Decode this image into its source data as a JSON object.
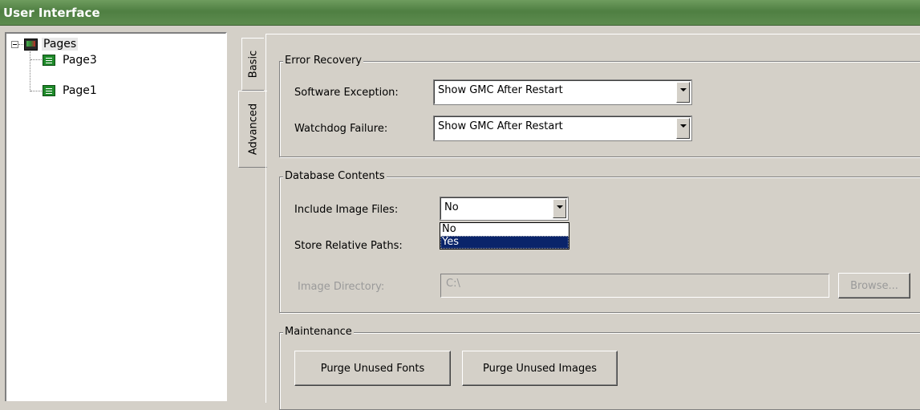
{
  "window": {
    "title": "User Interface"
  },
  "tree": {
    "root": {
      "label": "Pages",
      "icon": "monitor-icon",
      "expanded": true
    },
    "children": [
      {
        "label": "Page3",
        "icon": "page-icon"
      },
      {
        "label": "Page1",
        "icon": "page-icon"
      }
    ]
  },
  "tabs": [
    {
      "label": "Basic",
      "active": false
    },
    {
      "label": "Advanced",
      "active": true
    }
  ],
  "error_recovery": {
    "title": "Error Recovery",
    "software_exception": {
      "label": "Software Exception:",
      "value": "Show GMC After Restart"
    },
    "watchdog_failure": {
      "label": "Watchdog Failure:",
      "value": "Show GMC After Restart"
    }
  },
  "database_contents": {
    "title": "Database Contents",
    "include_image_files": {
      "label": "Include Image Files:",
      "value": "No",
      "options": [
        "No",
        "Yes"
      ],
      "highlighted": "Yes"
    },
    "store_relative_paths": {
      "label": "Store Relative Paths:"
    },
    "image_directory": {
      "label": "Image Directory:",
      "value": "C:\\",
      "disabled": true
    },
    "browse_button": {
      "label": "Browse...",
      "disabled": true
    }
  },
  "maintenance": {
    "title": "Maintenance",
    "purge_fonts_label": "Purge Unused Fonts",
    "purge_images_label": "Purge Unused Images"
  },
  "colors": {
    "titlebar": "#5d8c4f",
    "face": "#d4d0c8",
    "selection": "#0a246a"
  }
}
